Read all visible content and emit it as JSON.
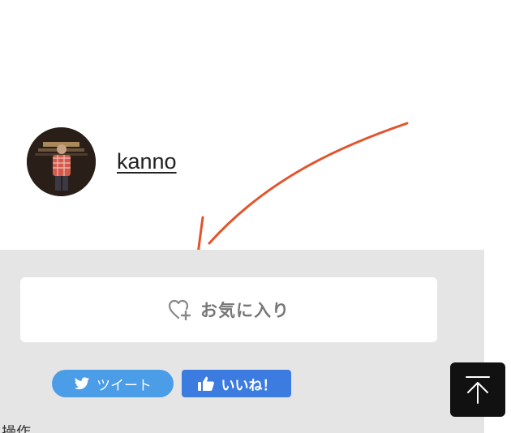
{
  "author": {
    "name": "kanno"
  },
  "actions": {
    "favorite_label": "お気に入り",
    "tweet_label": "ツイート",
    "like_label": "いいね！"
  },
  "footer": {
    "cut_text": "操作"
  },
  "icons": {
    "favorite": "heart-plus-icon",
    "tweet": "twitter-bird-icon",
    "like": "thumbs-up-icon",
    "back_to_top": "arrow-up-icon"
  },
  "colors": {
    "panel_bg": "#e5e5e5",
    "tweet_blue": "#4a9de6",
    "like_blue": "#3c7be0",
    "annotation_red": "#e2542c",
    "back_to_top_bg": "#111111"
  }
}
